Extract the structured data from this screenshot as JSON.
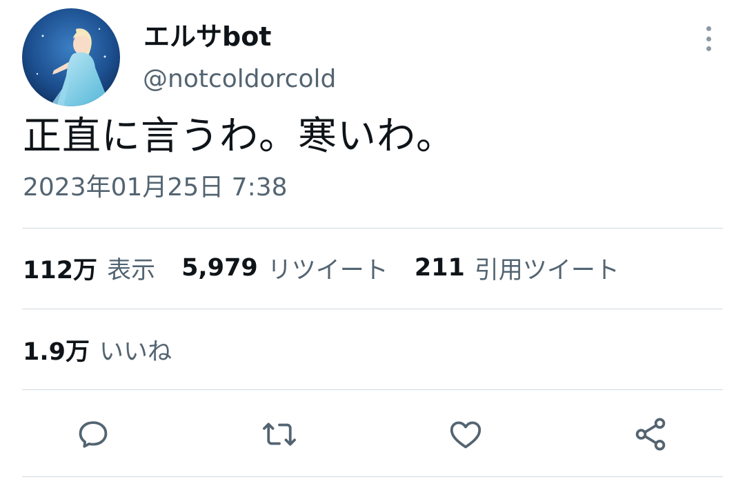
{
  "user": {
    "display_name": "エルサbot",
    "handle": "@notcoldorcold",
    "avatar_icon": "avatar-elsa-image"
  },
  "tweet": {
    "text": "正直に言うわ。寒いわ。",
    "timestamp": "2023年01月25日 7:38"
  },
  "stats": {
    "views_count": "112万",
    "views_label": "表示",
    "retweets_count": "5,979",
    "retweets_label": "リツイート",
    "quotes_count": "211",
    "quotes_label": "引用ツイート",
    "likes_count": "1.9万",
    "likes_label": "いいね"
  },
  "actions": [
    {
      "icon": "reply-icon"
    },
    {
      "icon": "retweet-icon"
    },
    {
      "icon": "like-icon"
    },
    {
      "icon": "share-icon"
    }
  ],
  "colors": {
    "text_primary": "#0f1419",
    "text_secondary": "#536471",
    "divider": "#cfd9de",
    "icon": "#536471"
  }
}
